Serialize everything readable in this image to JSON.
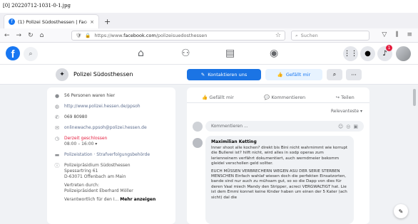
{
  "image_label": "[0] 20220712-1031-0-1.jpg",
  "browser": {
    "tab_title": "(1) Polizei Südosthessen | Face",
    "tab_close": "×",
    "new_tab": "+",
    "url_prefix": "https://www.",
    "url_domain": "facebook.com",
    "url_path": "/polizeisuedosthessen",
    "search_placeholder": "Suchen"
  },
  "facebook": {
    "logo": "f",
    "notifications_count": "1"
  },
  "page": {
    "name": "Polizei Südosthessen",
    "contact_button": "Kontaktieren uns",
    "like_button": "Gefällt mir"
  },
  "about": {
    "followers": "56 Personen waren hier",
    "website": "http://www.polizei.hessen.de/ppsoh",
    "phone": "069 80980",
    "email": "onlinewache.ppsoh@polizei.hessen.de",
    "status": "Derzeit geschlossen",
    "hours": "08:00 – 16:00 ▾",
    "category": "Polizeistation · Strafverfolgungsbehörde",
    "address_line1": "Polizeipräsidium Südosthessen",
    "address_line2": "Spessartring 61",
    "address_line3": "D-63071 Offenbach am Main",
    "represented_label": "Vertreten durch:",
    "represented_by": "Polizeipräsident Eberhard Möller",
    "responsible_prefix": "Verantwortlich für den I...",
    "more_link": "Mehr anzeigen"
  },
  "post": {
    "like": "Gefällt mir",
    "comment": "Kommentieren",
    "share": "Teilen",
    "sort_label": "Relevanteste ▾",
    "comment_placeholder": "Kommentieren ...",
    "comment_author": "Maximilian Ketting",
    "comment_para1": "Inner shoot alle kochen? direkt bis Bini nicht wahrnimmt wie korrupt die Bullerei ist? hilft nicht, wird alles in sodp operas zum lerienneinem verfährt dokumentiert, auch werndmeier bekomm gleidel verschollen geld sollter.",
    "comment_para2": "EUCH MÜSSEN VERBRECHERN WEGEN ASU DER SERIE STERBEN MENSCHEN Einfach wahlaf wiesen doch die perfekten Einsatzorten, bande sind nur auch zu mühsam gut, so so die Dapp von dies für deren Vaal miech Mandy den Stripper, acreci VERGWALTIGT hat. Lie ist dem Emmi konnet keine Kinder haben um einen der 5 Kater (ach sicht) dal die"
  },
  "icons": {
    "fb_search": "search-icon",
    "home": "home-icon",
    "friends": "friends-icon",
    "watch": "watch-icon",
    "groups": "groups-icon",
    "menu": "grid-menu-icon",
    "messenger": "messenger-icon",
    "bell": "bell-icon"
  },
  "colors": {
    "fb_blue": "#1877f2",
    "primary_button": "#1b74e4",
    "badge_red": "#e41e3f",
    "background": "#f0f2f5"
  }
}
